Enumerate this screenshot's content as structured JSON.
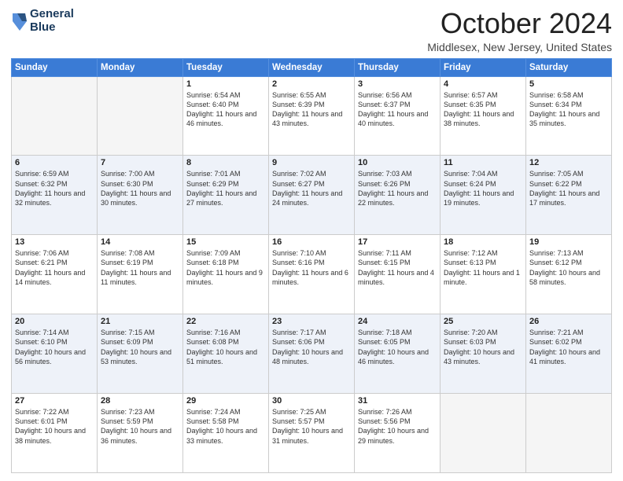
{
  "header": {
    "logo_line1": "General",
    "logo_line2": "Blue",
    "month": "October 2024",
    "location": "Middlesex, New Jersey, United States"
  },
  "days_of_week": [
    "Sunday",
    "Monday",
    "Tuesday",
    "Wednesday",
    "Thursday",
    "Friday",
    "Saturday"
  ],
  "weeks": [
    [
      {
        "day": "",
        "text": ""
      },
      {
        "day": "",
        "text": ""
      },
      {
        "day": "1",
        "text": "Sunrise: 6:54 AM\nSunset: 6:40 PM\nDaylight: 11 hours and 46 minutes."
      },
      {
        "day": "2",
        "text": "Sunrise: 6:55 AM\nSunset: 6:39 PM\nDaylight: 11 hours and 43 minutes."
      },
      {
        "day": "3",
        "text": "Sunrise: 6:56 AM\nSunset: 6:37 PM\nDaylight: 11 hours and 40 minutes."
      },
      {
        "day": "4",
        "text": "Sunrise: 6:57 AM\nSunset: 6:35 PM\nDaylight: 11 hours and 38 minutes."
      },
      {
        "day": "5",
        "text": "Sunrise: 6:58 AM\nSunset: 6:34 PM\nDaylight: 11 hours and 35 minutes."
      }
    ],
    [
      {
        "day": "6",
        "text": "Sunrise: 6:59 AM\nSunset: 6:32 PM\nDaylight: 11 hours and 32 minutes."
      },
      {
        "day": "7",
        "text": "Sunrise: 7:00 AM\nSunset: 6:30 PM\nDaylight: 11 hours and 30 minutes."
      },
      {
        "day": "8",
        "text": "Sunrise: 7:01 AM\nSunset: 6:29 PM\nDaylight: 11 hours and 27 minutes."
      },
      {
        "day": "9",
        "text": "Sunrise: 7:02 AM\nSunset: 6:27 PM\nDaylight: 11 hours and 24 minutes."
      },
      {
        "day": "10",
        "text": "Sunrise: 7:03 AM\nSunset: 6:26 PM\nDaylight: 11 hours and 22 minutes."
      },
      {
        "day": "11",
        "text": "Sunrise: 7:04 AM\nSunset: 6:24 PM\nDaylight: 11 hours and 19 minutes."
      },
      {
        "day": "12",
        "text": "Sunrise: 7:05 AM\nSunset: 6:22 PM\nDaylight: 11 hours and 17 minutes."
      }
    ],
    [
      {
        "day": "13",
        "text": "Sunrise: 7:06 AM\nSunset: 6:21 PM\nDaylight: 11 hours and 14 minutes."
      },
      {
        "day": "14",
        "text": "Sunrise: 7:08 AM\nSunset: 6:19 PM\nDaylight: 11 hours and 11 minutes."
      },
      {
        "day": "15",
        "text": "Sunrise: 7:09 AM\nSunset: 6:18 PM\nDaylight: 11 hours and 9 minutes."
      },
      {
        "day": "16",
        "text": "Sunrise: 7:10 AM\nSunset: 6:16 PM\nDaylight: 11 hours and 6 minutes."
      },
      {
        "day": "17",
        "text": "Sunrise: 7:11 AM\nSunset: 6:15 PM\nDaylight: 11 hours and 4 minutes."
      },
      {
        "day": "18",
        "text": "Sunrise: 7:12 AM\nSunset: 6:13 PM\nDaylight: 11 hours and 1 minute."
      },
      {
        "day": "19",
        "text": "Sunrise: 7:13 AM\nSunset: 6:12 PM\nDaylight: 10 hours and 58 minutes."
      }
    ],
    [
      {
        "day": "20",
        "text": "Sunrise: 7:14 AM\nSunset: 6:10 PM\nDaylight: 10 hours and 56 minutes."
      },
      {
        "day": "21",
        "text": "Sunrise: 7:15 AM\nSunset: 6:09 PM\nDaylight: 10 hours and 53 minutes."
      },
      {
        "day": "22",
        "text": "Sunrise: 7:16 AM\nSunset: 6:08 PM\nDaylight: 10 hours and 51 minutes."
      },
      {
        "day": "23",
        "text": "Sunrise: 7:17 AM\nSunset: 6:06 PM\nDaylight: 10 hours and 48 minutes."
      },
      {
        "day": "24",
        "text": "Sunrise: 7:18 AM\nSunset: 6:05 PM\nDaylight: 10 hours and 46 minutes."
      },
      {
        "day": "25",
        "text": "Sunrise: 7:20 AM\nSunset: 6:03 PM\nDaylight: 10 hours and 43 minutes."
      },
      {
        "day": "26",
        "text": "Sunrise: 7:21 AM\nSunset: 6:02 PM\nDaylight: 10 hours and 41 minutes."
      }
    ],
    [
      {
        "day": "27",
        "text": "Sunrise: 7:22 AM\nSunset: 6:01 PM\nDaylight: 10 hours and 38 minutes."
      },
      {
        "day": "28",
        "text": "Sunrise: 7:23 AM\nSunset: 5:59 PM\nDaylight: 10 hours and 36 minutes."
      },
      {
        "day": "29",
        "text": "Sunrise: 7:24 AM\nSunset: 5:58 PM\nDaylight: 10 hours and 33 minutes."
      },
      {
        "day": "30",
        "text": "Sunrise: 7:25 AM\nSunset: 5:57 PM\nDaylight: 10 hours and 31 minutes."
      },
      {
        "day": "31",
        "text": "Sunrise: 7:26 AM\nSunset: 5:56 PM\nDaylight: 10 hours and 29 minutes."
      },
      {
        "day": "",
        "text": ""
      },
      {
        "day": "",
        "text": ""
      }
    ]
  ]
}
